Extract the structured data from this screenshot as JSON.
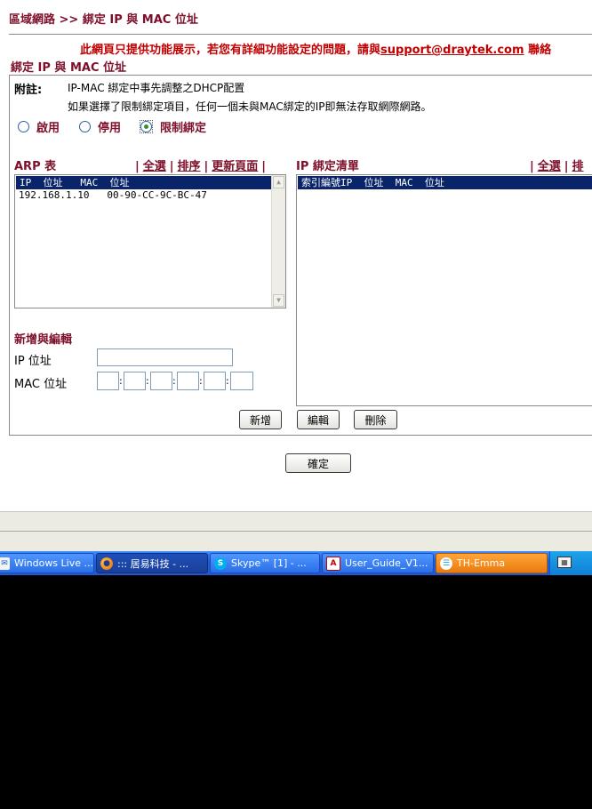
{
  "breadcrumb": "區域網路 >> 綁定 IP 與 MAC 位址",
  "notice": {
    "prefix": "此網頁只提供功能展示，若您有詳細功能設定的問題，請與",
    "link": "support@draytek.com",
    "suffix": " 聯絡"
  },
  "section_title": "綁定 IP 與 MAC 位址",
  "note": {
    "label": "附註:",
    "line1": "IP-MAC 綁定中事先調整之DHCP配置",
    "line2": "如果選擇了限制綁定項目，任何一個未與MAC綁定的IP即無法存取網際網路。"
  },
  "mode": {
    "options": [
      "啟用",
      "停用",
      "限制綁定"
    ],
    "selected": "限制綁定"
  },
  "arp": {
    "title": "ARP 表",
    "links": [
      "全選",
      "排序",
      "更新頁面"
    ],
    "header": "IP  位址   MAC  位址",
    "rows": [
      "192.168.1.10   00-90-CC-9C-BC-47"
    ]
  },
  "binding": {
    "title": "IP 綁定清單",
    "links": [
      "全選",
      "排"
    ],
    "header": "索引編號IP  位址  MAC  位址"
  },
  "edit": {
    "title": "新增與編輯",
    "ip_label": "IP 位址",
    "mac_label": "MAC 位址",
    "ip_value": "",
    "mac_values": [
      "",
      "",
      "",
      "",
      "",
      ""
    ]
  },
  "buttons": {
    "add": "新增",
    "edit": "編輯",
    "delete": "刪除",
    "ok": "確定"
  },
  "taskbar": {
    "items": [
      {
        "label": "Windows Live ...",
        "icon": "windows-live-icon",
        "state": "normal"
      },
      {
        "label": "::: 居易科技 - ...",
        "icon": "firefox-icon",
        "state": "active"
      },
      {
        "label": "Skype™ [1] - ...",
        "icon": "skype-icon",
        "state": "normal"
      },
      {
        "label": "User_Guide_V1...",
        "icon": "pdf-icon",
        "state": "normal"
      },
      {
        "label": "TH-Emma",
        "icon": "chat-icon",
        "state": "flash"
      }
    ]
  },
  "colors": {
    "accent": "#7d0f2a",
    "notice": "#c00000",
    "selection": "#0a246a"
  }
}
